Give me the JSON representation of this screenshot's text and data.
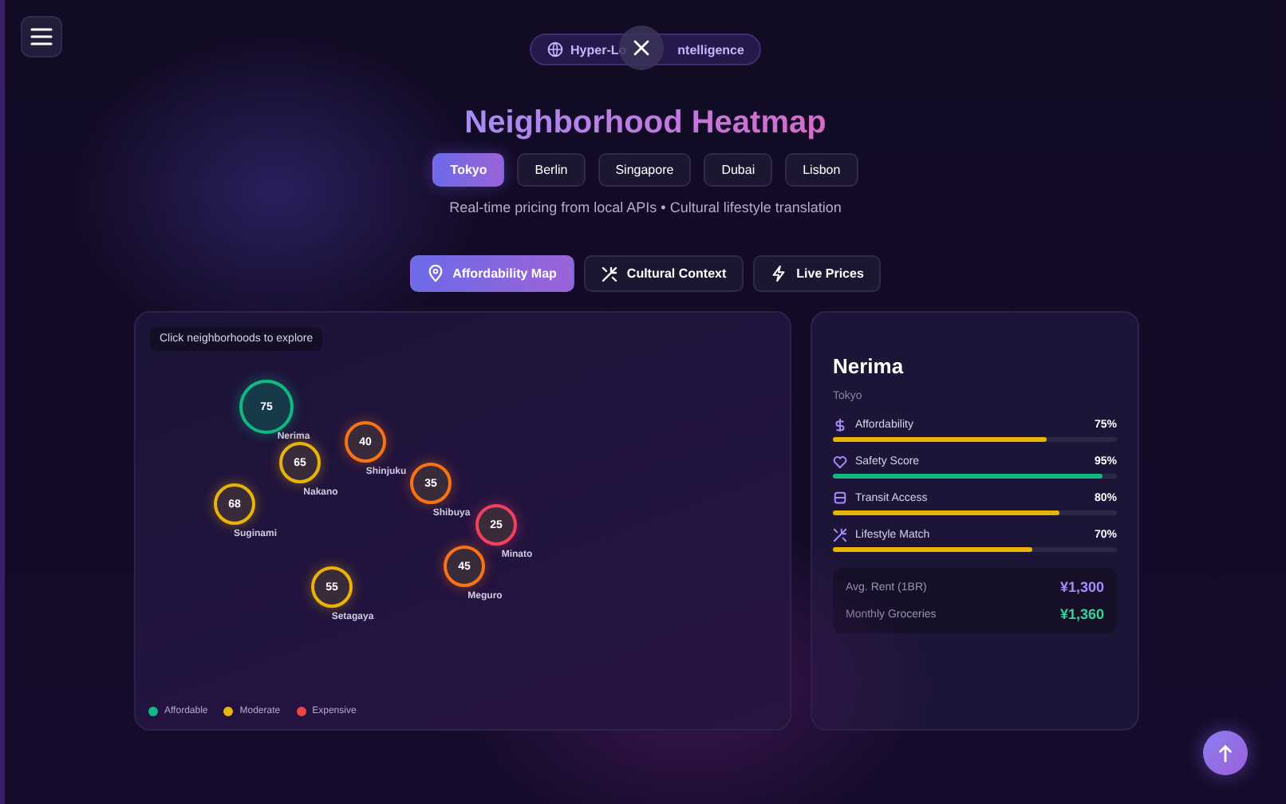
{
  "badge": {
    "text_before": "Hyper-Lo",
    "text_after": "ntelligence"
  },
  "title": "Neighborhood Heatmap",
  "cities": [
    {
      "label": "Tokyo",
      "selected": true
    },
    {
      "label": "Berlin",
      "selected": false
    },
    {
      "label": "Singapore",
      "selected": false
    },
    {
      "label": "Dubai",
      "selected": false
    },
    {
      "label": "Lisbon",
      "selected": false
    }
  ],
  "subtitle": "Real-time pricing from local APIs • Cultural lifestyle translation",
  "views": [
    {
      "label": "Affordability Map",
      "kind": "pin",
      "selected": true
    },
    {
      "label": "Cultural Context",
      "kind": "sparkle",
      "selected": false
    },
    {
      "label": "Live Prices",
      "kind": "bolt",
      "selected": false
    }
  ],
  "map": {
    "hint": "Click neighborhoods to explore",
    "neighborhoods": [
      {
        "name": "Nerima",
        "score": "75",
        "color": "#10b981",
        "selected": true
      },
      {
        "name": "Nakano",
        "score": "65",
        "color": "#eab308",
        "selected": false
      },
      {
        "name": "Shinjuku",
        "score": "40",
        "color": "#f97316",
        "selected": false
      },
      {
        "name": "Shibuya",
        "score": "35",
        "color": "#f97316",
        "selected": false
      },
      {
        "name": "Minato",
        "score": "25",
        "color": "#f43f5e",
        "selected": false
      },
      {
        "name": "Meguro",
        "score": "45",
        "color": "#f97316",
        "selected": false
      },
      {
        "name": "Suginami",
        "score": "68",
        "color": "#eab308",
        "selected": false
      },
      {
        "name": "Setagaya",
        "score": "55",
        "color": "#eab308",
        "selected": false
      }
    ],
    "legend": [
      {
        "label": "Affordable",
        "color": "#10b981"
      },
      {
        "label": "Moderate",
        "color": "#eab308"
      },
      {
        "label": "Expensive",
        "color": "#ef4444"
      }
    ]
  },
  "detail": {
    "name": "Nerima",
    "city": "Tokyo",
    "metrics": [
      {
        "label": "Affordability",
        "kind": "dollar",
        "reading": "75%",
        "level": 0.75,
        "color": "#eab308"
      },
      {
        "label": "Safety Score",
        "kind": "heart",
        "reading": "95%",
        "level": 0.95,
        "color": "#10b981"
      },
      {
        "label": "Transit Access",
        "kind": "train",
        "reading": "80%",
        "level": 0.8,
        "color": "#eab308"
      },
      {
        "label": "Lifestyle Match",
        "kind": "sparkle",
        "reading": "70%",
        "level": 0.7,
        "color": "#eab308"
      }
    ],
    "costs": [
      {
        "label": "Avg. Rent (1BR)",
        "value": "¥1,300",
        "color": "#a78bfa"
      },
      {
        "label": "Monthly Groceries",
        "value": "¥1,360",
        "color": "#34d399"
      }
    ]
  }
}
